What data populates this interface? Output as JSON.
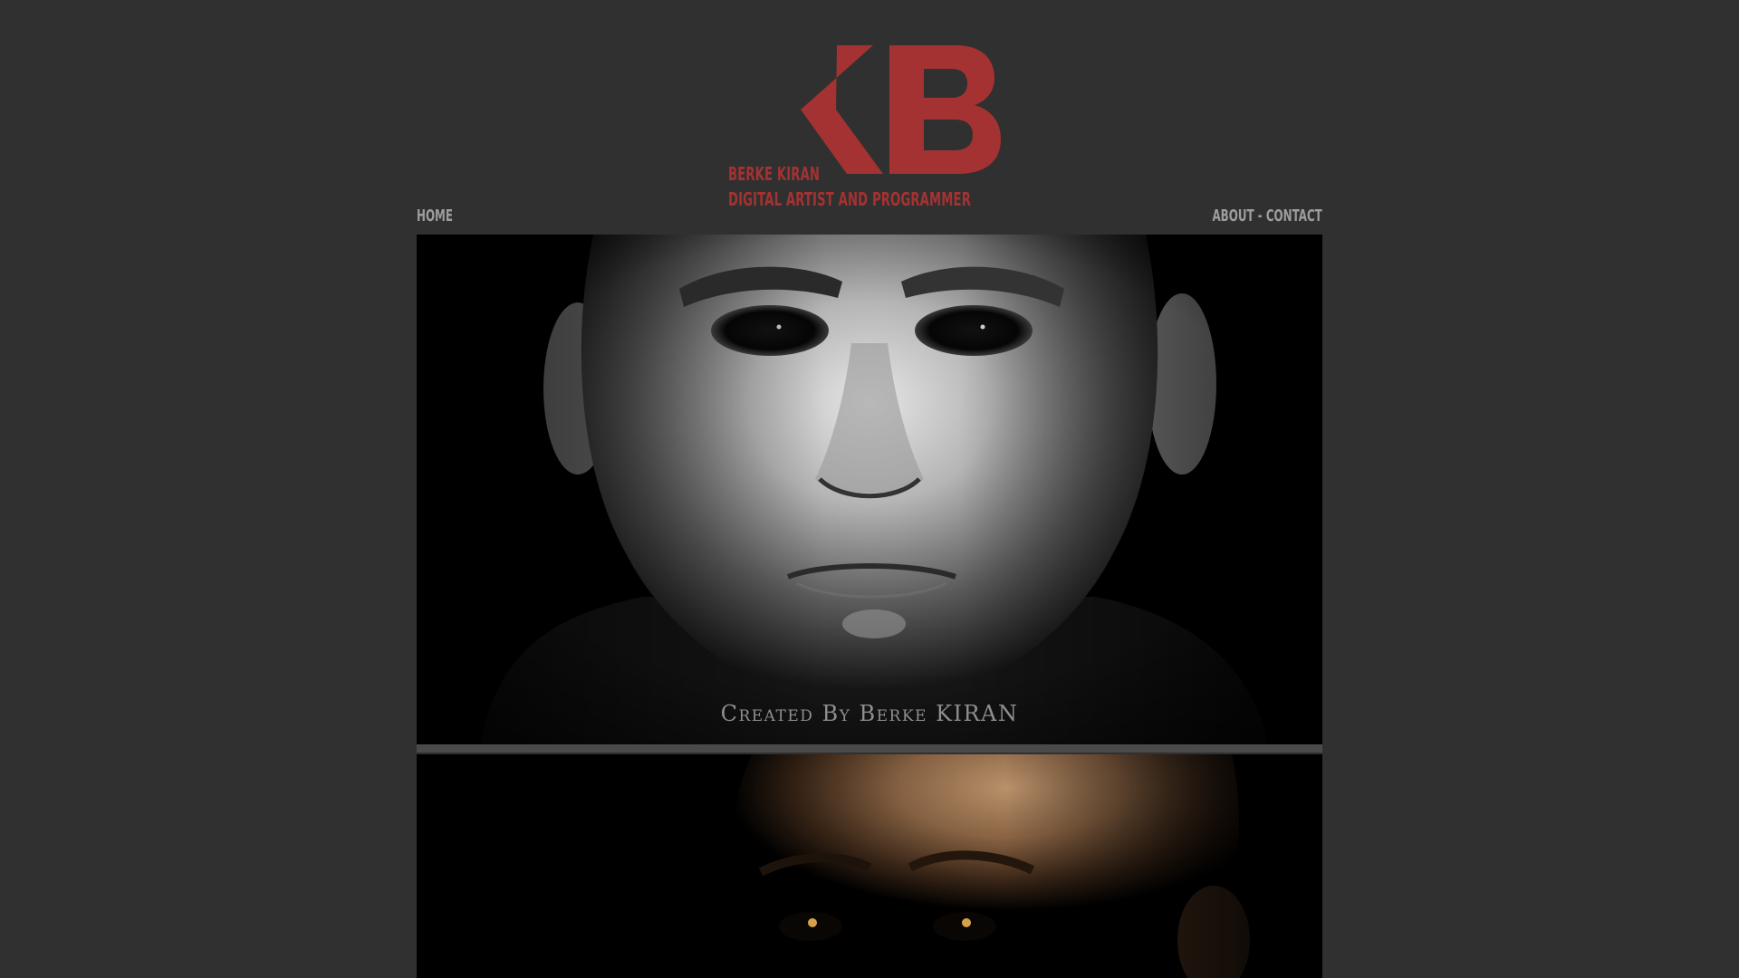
{
  "brand": {
    "monogram": "KB",
    "name": "BERKE KIRAN",
    "tagline": "DIGITAL ARTIST AND PROGRAMMER",
    "accent_color": "#a43232"
  },
  "nav": {
    "home": "HOME",
    "about": "ABOUT",
    "separator": "-",
    "contact": "CONTACT"
  },
  "gallery": {
    "items": [
      {
        "subject": "3D render of a pale bald male head with dark eyes",
        "caption": "Created By Berke KIRAN"
      },
      {
        "subject": "3D render of a bronze-lit bald male head with glowing eyes"
      }
    ]
  },
  "colors": {
    "background": "#303030",
    "nav_text": "#9d9d9d",
    "image_background": "#000000"
  }
}
